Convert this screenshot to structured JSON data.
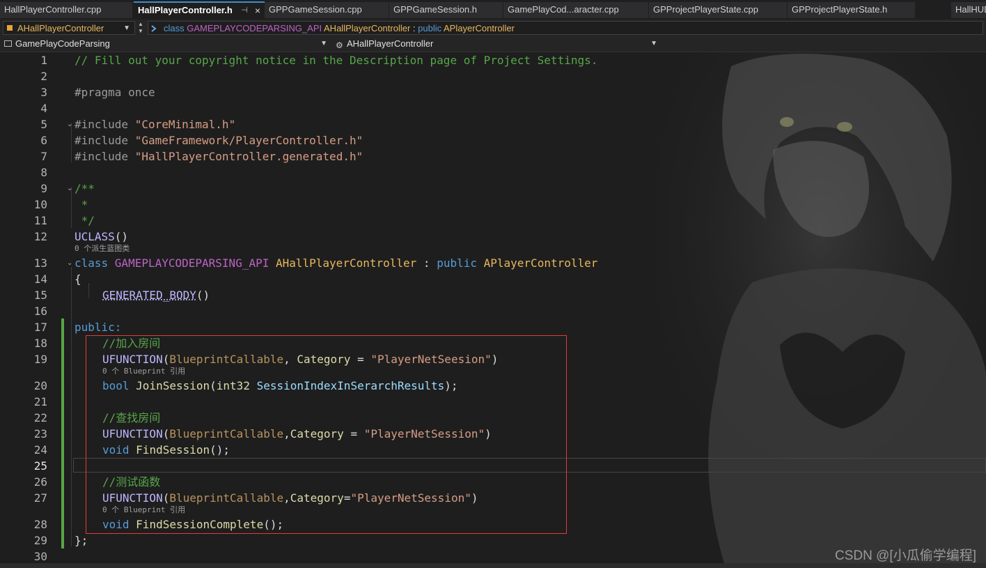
{
  "tabs": [
    {
      "label": "HallPlayerController.cpp"
    },
    {
      "label": "HallPlayerController.h"
    },
    {
      "label": "GPPGameSession.cpp"
    },
    {
      "label": "GPPGameSession.h"
    },
    {
      "label": "GamePlayCod...aracter.cpp"
    },
    {
      "label": "GPProjectPlayerState.cpp"
    },
    {
      "label": "GPProjectPlayerState.h"
    },
    {
      "label": "HallHUD"
    }
  ],
  "active_tab_close": "×",
  "nav": {
    "class_scope": "AHallPlayerController",
    "signature": {
      "kw_class": "class",
      "api": "GAMEPLAYCODEPARSING_API",
      "name": "AHallPlayerController",
      "sep": " : ",
      "kw_public": "public",
      "base": "APlayerController"
    },
    "project": "GamePlayCodeParsing",
    "member": "AHallPlayerController"
  },
  "line_numbers": [
    "1",
    "2",
    "3",
    "4",
    "5",
    "6",
    "7",
    "8",
    "9",
    "10",
    "11",
    "12",
    "13",
    "14",
    "15",
    "16",
    "17",
    "18",
    "19",
    "20",
    "21",
    "22",
    "23",
    "24",
    "25",
    "26",
    "27",
    "28",
    "29",
    "30"
  ],
  "code": {
    "l1": "// Fill out your copyright notice in the Description page of Project Settings.",
    "l3": "#pragma once",
    "l5_inc": "#include ",
    "l5_str": "\"CoreMinimal.h\"",
    "l6_inc": "#include ",
    "l6_str": "\"GameFramework/PlayerController.h\"",
    "l7_inc": "#include ",
    "l7_str": "\"HallPlayerController.generated.h\"",
    "l9": "/**",
    "l10": " *",
    "l11": " */",
    "l12_macro": "UCLASS",
    "l12_paren": "()",
    "hint_derived": "0 个派生蓝图类",
    "l13_class": "class ",
    "l13_api": "GAMEPLAYCODEPARSING_API ",
    "l13_name": "AHallPlayerController",
    "l13_colon": " : ",
    "l13_public": "public ",
    "l13_base": "APlayerController",
    "l14": "{",
    "l15_macro": "GENERATED_BODY",
    "l15_paren": "()",
    "l17": "public:",
    "l18": "//加入房间",
    "l19_macro": "UFUNCTION",
    "l19_open": "(",
    "l19_spec": "BlueprintCallable",
    "l19_comma": ", ",
    "l19_cat": "Category",
    "l19_eq": " = ",
    "l19_str": "\"PlayerNetSeesion\"",
    "l19_close": ")",
    "hint_bp1": "0 个 Blueprint 引用",
    "l20_type": "bool ",
    "l20_fn": "JoinSession",
    "l20_open": "(",
    "l20_ptype": "int32 ",
    "l20_param": "SessionIndexInSerarchResults",
    "l20_close": ");",
    "l22": "//查找房间",
    "l23_macro": "UFUNCTION",
    "l23_open": "(",
    "l23_spec": "BlueprintCallable",
    "l23_comma": ",",
    "l23_cat": "Category",
    "l23_eq": " = ",
    "l23_str": "\"PlayerNetSession\"",
    "l23_close": ")",
    "l24_type": "void ",
    "l24_fn": "FindSession",
    "l24_rest": "();",
    "l26": "//测试函数",
    "l27_macro": "UFUNCTION",
    "l27_open": "(",
    "l27_spec": "BlueprintCallable",
    "l27_comma": ",",
    "l27_cat": "Category",
    "l27_eq": "=",
    "l27_str": "\"PlayerNetSession\"",
    "l27_close": ")",
    "hint_bp2": "0 个 Blueprint 引用",
    "l28_type": "void ",
    "l28_fn": "FindSessionComplete",
    "l28_rest": "();",
    "l29": "};"
  },
  "watermark": "CSDN @[小瓜偷学编程]",
  "colors": {
    "comment": "#57a64a",
    "keyword": "#569cd6",
    "string": "#d69d85",
    "class_name": "#4ec9b0",
    "function": "#dcdcaa",
    "highlight_box": "#e03c3c",
    "changed_bar": "#57a64a"
  },
  "icons": [
    "pin-icon",
    "close-icon",
    "class-icon",
    "dropdown-chevron-icon",
    "project-icon",
    "member-icon"
  ]
}
